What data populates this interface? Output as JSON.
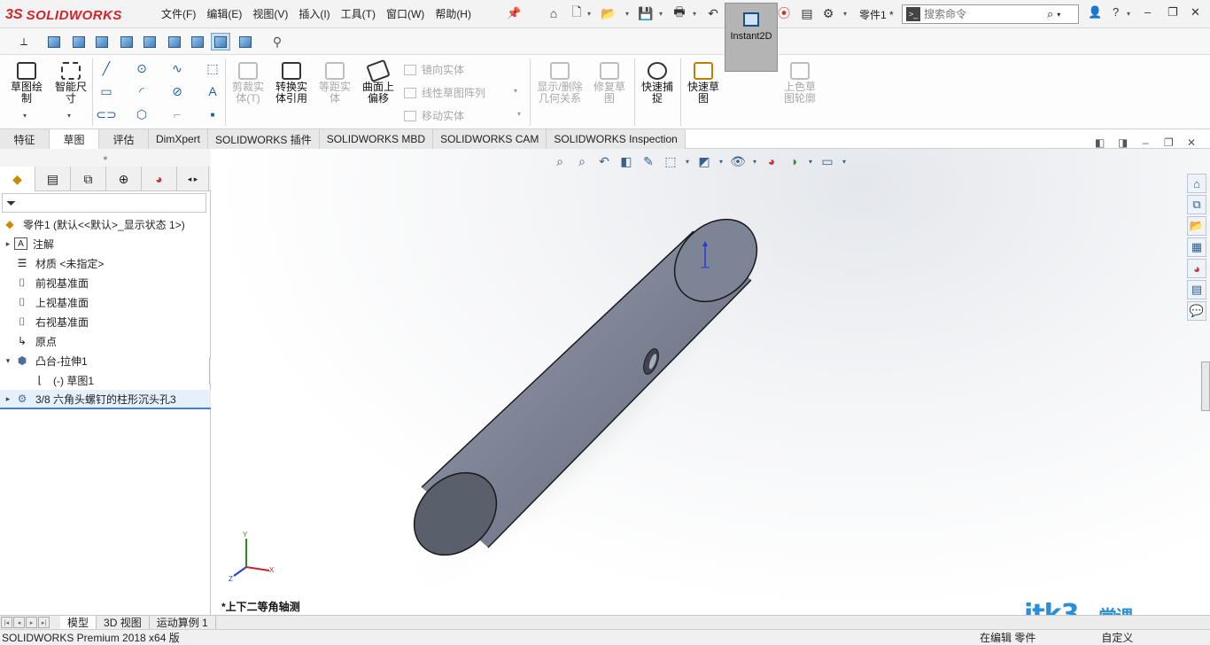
{
  "app": {
    "brand_ds": "3S",
    "brand_name": "SOLIDWORKS",
    "document": "零件1 *"
  },
  "menu": [
    "文件(F)",
    "编辑(E)",
    "视图(V)",
    "插入(I)",
    "工具(T)",
    "窗口(W)",
    "帮助(H)"
  ],
  "search": {
    "placeholder": "搜索命令"
  },
  "command_manager": {
    "sketch": "草图绘\n制",
    "smart_dim": "智能尺\n寸",
    "trim": "剪裁实\n体(T)",
    "convert": "转换实\n体引用",
    "offset_ent": "等距实\n体",
    "offset_surface": "曲面上\n偏移",
    "mirror": "镜向实体",
    "linear_pattern": "线性草图阵列",
    "move": "移动实体",
    "display_delete": "显示/删除\n几何关系",
    "repair": "修复草\n图",
    "quick_snap": "快速捕\n捉",
    "rapid_sketch": "快速草\n图",
    "instant2d": "Instant2D",
    "shaded_contour": "上色草\n图轮廓"
  },
  "tabs": [
    "特征",
    "草图",
    "评估",
    "DimXpert",
    "SOLIDWORKS 插件",
    "SOLIDWORKS MBD",
    "SOLIDWORKS CAM",
    "SOLIDWORKS Inspection"
  ],
  "active_tab": "草图",
  "feature_tree": {
    "root": "零件1 (默认<<默认>_显示状态 1>)",
    "annotations": "注解",
    "material": "材质 <未指定>",
    "front_plane": "前视基准面",
    "top_plane": "上视基准面",
    "right_plane": "右视基准面",
    "origin": "原点",
    "extrude": "凸台-拉伸1",
    "sketch": "(-) 草图1",
    "hole": "3/8 六角头螺钉的柱形沉头孔3"
  },
  "graphics": {
    "view_name": "*上下二等角轴测",
    "triad_x": "X",
    "triad_y": "Y",
    "triad_z": "Z"
  },
  "bottom_tabs": [
    "模型",
    "3D 视图",
    "运动算例 1"
  ],
  "status": {
    "left": "SOLIDWORKS Premium 2018 x64 版",
    "editing": "在编辑 零件",
    "custom": "自定义"
  },
  "watermark": {
    "main": "itk3",
    "sub": "一堂课",
    "domain": ".com"
  },
  "colors": {
    "brand_red": "#d2232a",
    "cylinder": "#7f8698",
    "accent_blue": "#2b8fd8"
  }
}
